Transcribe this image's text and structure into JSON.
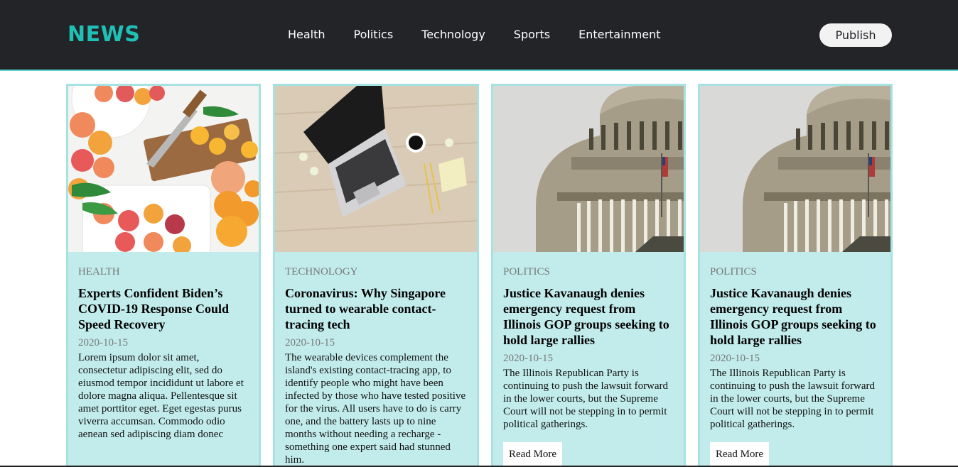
{
  "header": {
    "logo": "NEWS",
    "nav": [
      "Health",
      "Politics",
      "Technology",
      "Sports",
      "Entertainment"
    ],
    "publish_label": "Publish"
  },
  "colors": {
    "navbar": "#232428",
    "accent": "#1fc0b6",
    "card_bg": "#c2ecec"
  },
  "cards": [
    {
      "image": "citrus-fruits-photo",
      "category": "HEALTH",
      "title": "Experts Confident Biden’s COVID-19 Response Could Speed Recovery",
      "date": "2020-10-15",
      "excerpt": "Lorem ipsum dolor sit amet, consectetur adipiscing elit, sed do eiusmod tempor incididunt ut labore et dolore magna aliqua. Pellentesque sit amet porttitor eget. Eget egestas purus viverra accumsan. Commodo odio aenean sed adipiscing diam donec"
    },
    {
      "image": "laptop-desk-photo",
      "category": "TECHNOLOGY",
      "title": "Coronavirus: Why Singapore turned to wearable contact-tracing tech",
      "date": "2020-10-15",
      "excerpt": "The wearable devices complement the island's existing contact-tracing app, to identify people who might have been infected by those who have tested positive for the virus. All users have to do is carry one, and the battery lasts up to nine months without needing a recharge - something one expert said had stunned him."
    },
    {
      "image": "capitol-dome-photo",
      "category": "POLITICS",
      "title": "Justice Kavanaugh denies emergency request from Illinois GOP groups seeking to hold large rallies",
      "date": "2020-10-15",
      "excerpt": "The Illinois Republican Party is continuing to push the lawsuit forward in the lower courts, but the Supreme Court will not be stepping in to permit political gatherings.",
      "read_more": "Read More"
    },
    {
      "image": "capitol-dome-photo",
      "category": "POLITICS",
      "title": "Justice Kavanaugh denies emergency request from Illinois GOP groups seeking to hold large rallies",
      "date": "2020-10-15",
      "excerpt": "The Illinois Republican Party is continuing to push the lawsuit forward in the lower courts, but the Supreme Court will not be stepping in to permit political gatherings.",
      "read_more": "Read More"
    }
  ]
}
